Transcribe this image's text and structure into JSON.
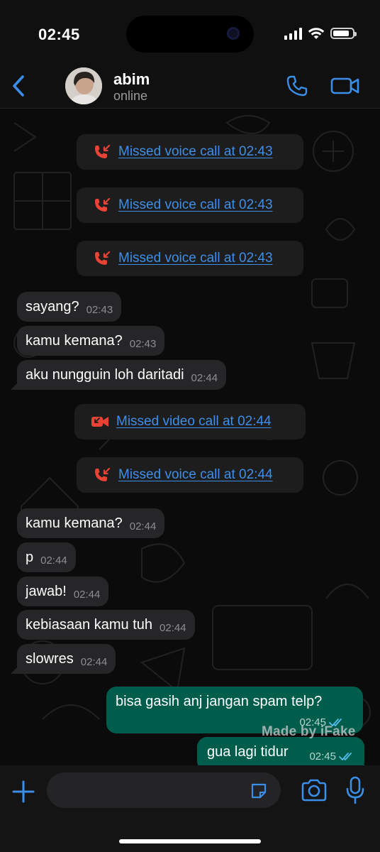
{
  "status_bar": {
    "time": "02:45",
    "battery_level": 0.85
  },
  "header": {
    "name": "abim",
    "status": "online",
    "icons": [
      "back-chevron-icon",
      "phone-icon",
      "video-camera-icon"
    ],
    "accent": "#3b8ee8"
  },
  "messages": {
    "m1": {
      "text": "Missed voice call at 02:43",
      "icon": "missed-voice-call-icon"
    },
    "m2": {
      "text": "Missed voice call at 02:43",
      "icon": "missed-voice-call-icon"
    },
    "m3": {
      "text": "Missed voice call at 02:43",
      "icon": "missed-voice-call-icon"
    },
    "m4": {
      "text": "sayang?",
      "time": "02:43"
    },
    "m5": {
      "text": "kamu kemana?",
      "time": "02:43"
    },
    "m6": {
      "text": "aku nungguin loh daritadi",
      "time": "02:44"
    },
    "m7": {
      "text": "Missed video call at 02:44",
      "icon": "missed-video-call-icon"
    },
    "m8": {
      "text": "Missed voice call at 02:44",
      "icon": "missed-voice-call-icon"
    },
    "m9": {
      "text": "kamu kemana?",
      "time": "02:44"
    },
    "m10": {
      "text": "p",
      "time": "02:44"
    },
    "m11": {
      "text": "jawab!",
      "time": "02:44"
    },
    "m12": {
      "text": "kebiasaan kamu tuh",
      "time": "02:44"
    },
    "m13": {
      "text": "slowres",
      "time": "02:44"
    },
    "m14": {
      "text": "bisa gasih anj jangan spam telp?",
      "time": "02:45",
      "receipt": "read-double-check-icon"
    },
    "m15": {
      "text": "gua lagi tidur",
      "time": "02:45",
      "receipt": "read-double-check-icon"
    }
  },
  "watermark": "Made by iFake",
  "input_bar": {
    "icons": [
      "plus-icon",
      "sticker-icon",
      "camera-icon",
      "microphone-icon"
    ]
  },
  "colors": {
    "incoming_bubble": "#262628",
    "outgoing_bubble": "#005c4b",
    "system_bubble": "#1d1d1d",
    "missed_call": "#ea4335",
    "link": "#3f8ee8"
  }
}
